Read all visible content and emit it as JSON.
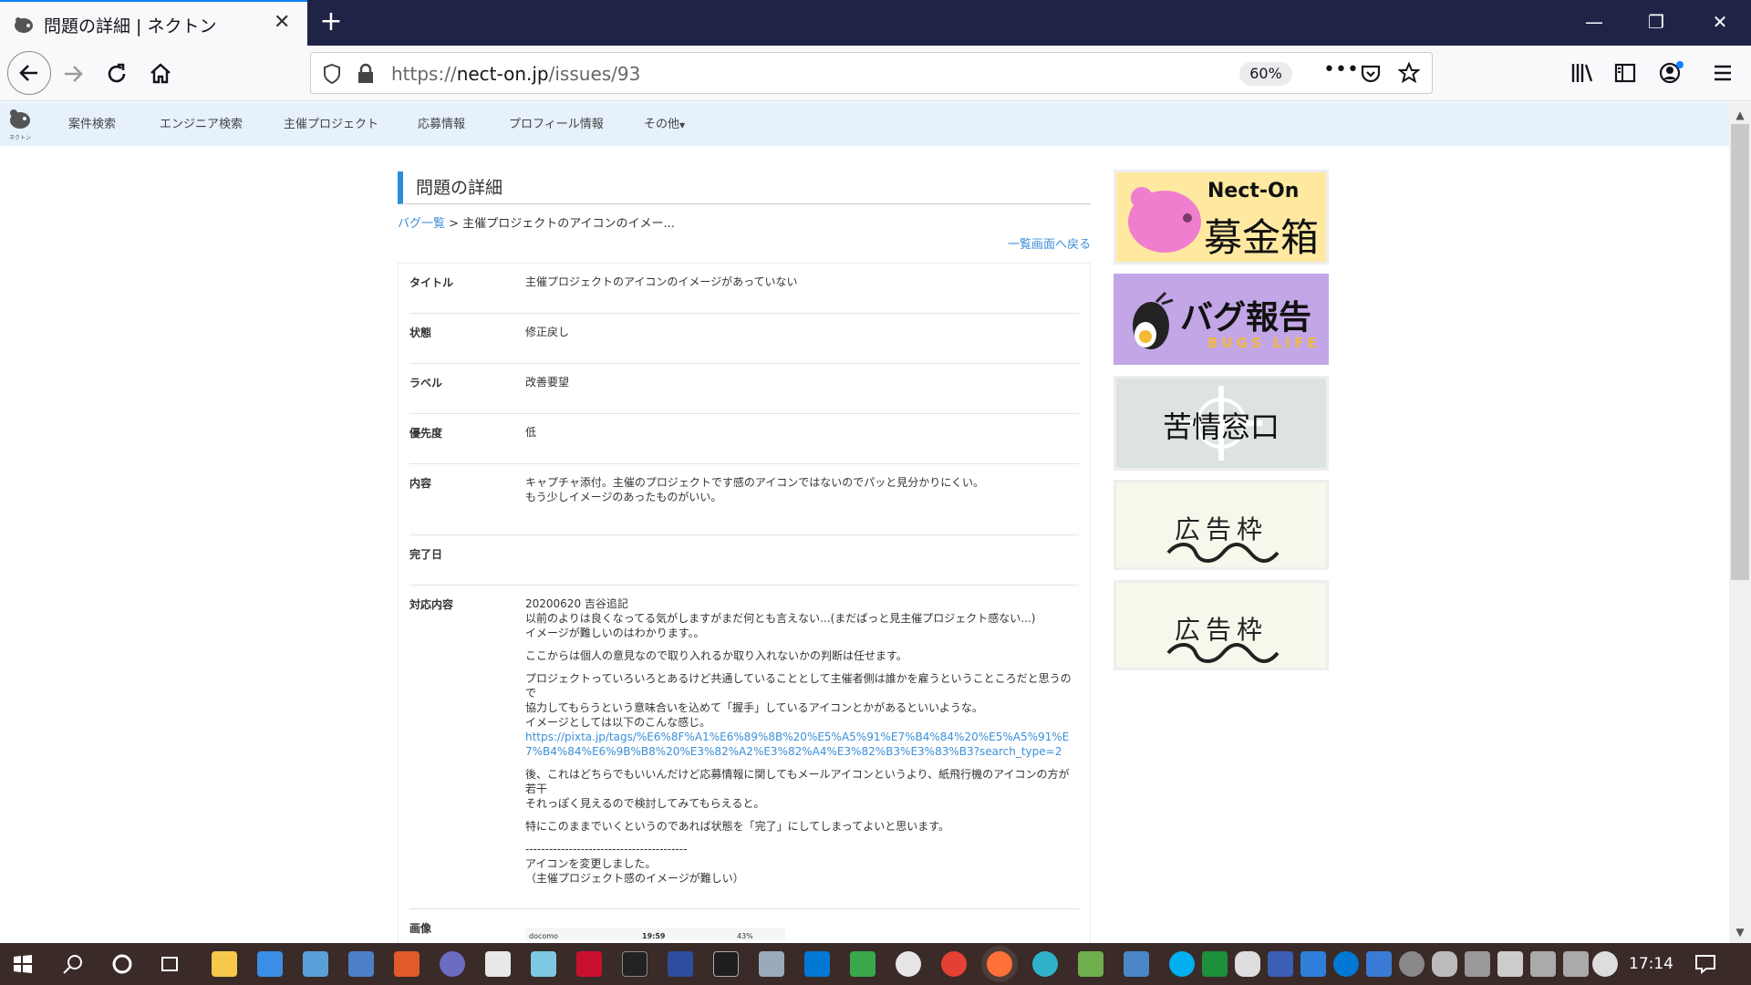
{
  "browser": {
    "tab_title": "問題の詳細 | ネクトン",
    "url_prefix": "https://",
    "url_domain": "nect-on.jp",
    "url_path": "/issues/93",
    "zoom": "60%"
  },
  "site_nav": {
    "logo_text": "ネクトン",
    "items": [
      "案件検索",
      "エンジニア検索",
      "主催プロジェクト",
      "応募情報",
      "プロフィール情報",
      "その他"
    ]
  },
  "page": {
    "title": "問題の詳細",
    "breadcrumb_link": "バグ一覧",
    "breadcrumb_sep": " > ",
    "breadcrumb_current": "主催プロジェクトのアイコンのイメー...",
    "back_link": "一覧画面へ戻る"
  },
  "detail": {
    "title_label": "タイトル",
    "title_value": "主催プロジェクトのアイコンのイメージがあっていない",
    "status_label": "状態",
    "status_value": "修正戻し",
    "label_label": "ラベル",
    "label_value": "改善要望",
    "priority_label": "優先度",
    "priority_value": "低",
    "content_label": "内容",
    "content_line1": "キャプチャ添付。主催のプロジェクトです感のアイコンではないのでパッと見分かりにくい。",
    "content_line2": "もう少しイメージのあったものがいい。",
    "done_label": "完了日",
    "done_value": "",
    "response_label": "対応内容",
    "response_p1_l1": "20200620 吉谷追記",
    "response_p1_l2": "以前のよりは良くなってる気がしますがまだ何とも言えない...(まだぱっと見主催プロジェクト感ない...)",
    "response_p1_l3": "イメージが難しいのはわかります。。",
    "response_p2": "ここからは個人の意見なので取り入れるか取り入れないかの判断は任せます。",
    "response_p3_l1": "プロジェクトっていろいろとあるけど共通していることとして主催者側は誰かを雇うということころだと思うので",
    "response_p3_l2": "協力してもらうという意味合いを込めて「握手」しているアイコンとかがあるといいような。",
    "response_p3_l3": "イメージとしては以下のこんな感じ。",
    "response_url": "https://pixta.jp/tags/%E6%8F%A1%E6%89%8B%20%E5%A5%91%E7%B4%84%20%E5%A5%91%E7%B4%84%E6%9B%B8%20%E3%82%A2%E3%82%A4%E3%82%B3%E3%83%B3?search_type=2",
    "response_p4_l1": "後、これはどちらでもいいんだけど応募情報に関してもメールアイコンというより、紙飛行機のアイコンの方が若干",
    "response_p4_l2": "それっぽく見えるので検討してみてもらえると。",
    "response_p5": "特にこのままでいくというのであれば状態を「完了」にしてしまってよいと思います。",
    "response_divider": "-----------------------------------------",
    "response_p6_l1": "アイコンを変更しました。",
    "response_p6_l2": "（主催プロジェクト感のイメージが難しい）",
    "image_label": "画像",
    "image_status_carrier": "docomo",
    "image_status_time": "19:59",
    "image_status_battery": "43%"
  },
  "sidebar": {
    "banner1_brand": "Nect-On",
    "banner1_text": "募金箱",
    "banner2_text": "バグ報告",
    "banner2_sub": "BUGS LIFE",
    "banner3_text": "苦情窓口",
    "banner4_text": "広告枠",
    "banner5_text": "広告枠"
  },
  "taskbar": {
    "clock": "17:14"
  },
  "colors": {
    "accent": "#2b8fd6",
    "link": "#3b8fd8",
    "titlebar": "#1f2345",
    "site_nav_bg": "#e6f1fb"
  }
}
